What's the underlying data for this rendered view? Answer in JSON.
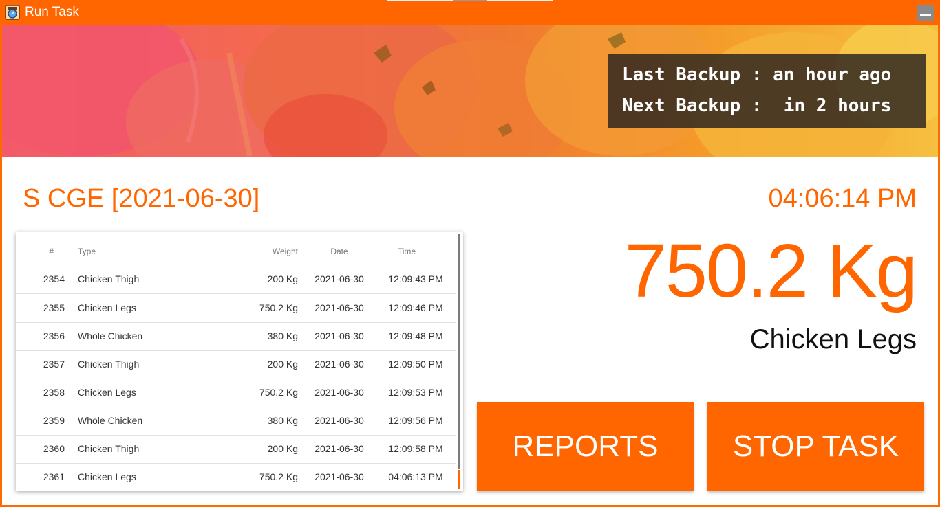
{
  "window": {
    "title": "Run Task"
  },
  "banner": {
    "last_backup_label": "Last Backup : an hour ago",
    "next_backup_label": "Next Backup :  in 2 hours"
  },
  "session": {
    "title": "S CGE [2021-06-30]",
    "clock": "04:06:14 PM"
  },
  "scale": {
    "weight": "750.2 Kg",
    "product": "Chicken Legs"
  },
  "table": {
    "headers": {
      "id": "#",
      "type": "Type",
      "weight": "Weight",
      "date": "Date",
      "time": "Time"
    },
    "rows": [
      {
        "id": "2354",
        "type": "Chicken Thigh",
        "weight": "200 Kg",
        "date": "2021-06-30",
        "time": "12:09:43 PM"
      },
      {
        "id": "2355",
        "type": "Chicken Legs",
        "weight": "750.2 Kg",
        "date": "2021-06-30",
        "time": "12:09:46 PM"
      },
      {
        "id": "2356",
        "type": "Whole Chicken",
        "weight": "380 Kg",
        "date": "2021-06-30",
        "time": "12:09:48 PM"
      },
      {
        "id": "2357",
        "type": "Chicken Thigh",
        "weight": "200 Kg",
        "date": "2021-06-30",
        "time": "12:09:50 PM"
      },
      {
        "id": "2358",
        "type": "Chicken Legs",
        "weight": "750.2 Kg",
        "date": "2021-06-30",
        "time": "12:09:53 PM"
      },
      {
        "id": "2359",
        "type": "Whole Chicken",
        "weight": "380 Kg",
        "date": "2021-06-30",
        "time": "12:09:56 PM"
      },
      {
        "id": "2360",
        "type": "Chicken Thigh",
        "weight": "200 Kg",
        "date": "2021-06-30",
        "time": "12:09:58 PM"
      },
      {
        "id": "2361",
        "type": "Chicken Legs",
        "weight": "750.2 Kg",
        "date": "2021-06-30",
        "time": "04:06:13 PM"
      }
    ]
  },
  "actions": {
    "reports_label": "REPORTS",
    "stop_label": "STOP TASK"
  },
  "colors": {
    "accent": "#ff6600",
    "title_bar": "#ff6600",
    "minimize_button": "#8a8a8a",
    "scroll_thumb": "#ff6600"
  },
  "icons": {
    "app": "scale-icon",
    "minimize": "minimize-icon"
  }
}
